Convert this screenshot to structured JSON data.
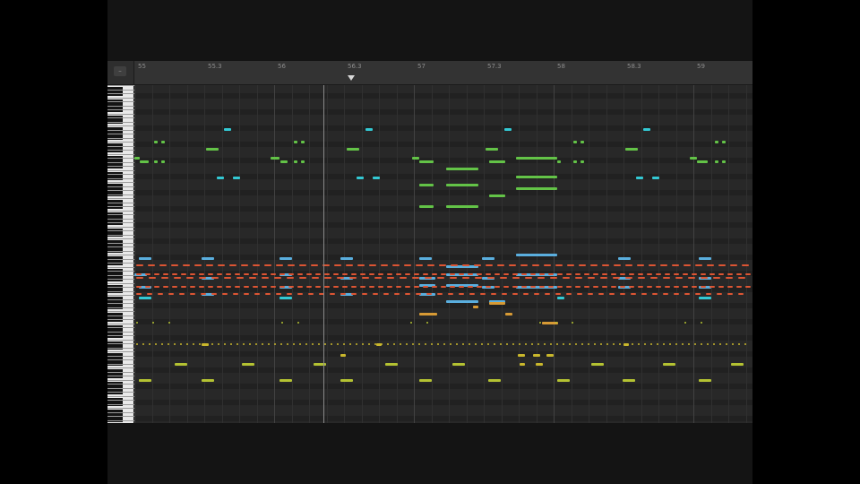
{
  "ruler": {
    "corner_icon": "minus-icon",
    "labels": [
      "55",
      "55.3",
      "56",
      "56.3",
      "57",
      "57.3",
      "58",
      "58.3",
      "59"
    ]
  },
  "colors": {
    "green": "#63c347",
    "cyan": "#33c9d4",
    "blue": "#5aaede",
    "red": "#dd5533",
    "orange": "#d79a35",
    "yellow": "#c9b72c",
    "lime": "#b4c232"
  }
}
